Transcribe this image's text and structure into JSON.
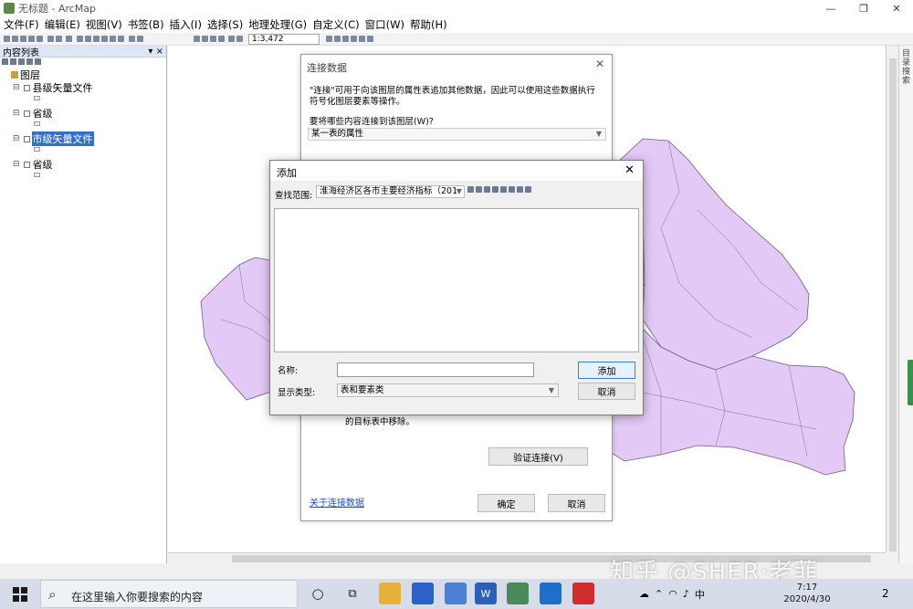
{
  "window": {
    "title": "无标题 - ArcMap"
  },
  "menu": [
    "文件(F)",
    "编辑(E)",
    "视图(V)",
    "书签(B)",
    "插入(I)",
    "选择(S)",
    "地理处理(G)",
    "自定义(C)",
    "窗口(W)",
    "帮助(H)"
  ],
  "toolbar": {
    "scale": "1:3,472"
  },
  "toc": {
    "title": "内容列表",
    "root": "图层",
    "layers": [
      {
        "label": "县级矢量文件",
        "selected": false
      },
      {
        "label": "省级",
        "selected": false
      },
      {
        "label": "市级矢量文件",
        "selected": true
      },
      {
        "label": "省级",
        "selected": false
      }
    ]
  },
  "right_panel": {
    "label": "目录 搜索"
  },
  "join_dialog": {
    "title": "连接数据",
    "description": "\"连接\"可用于向该图层的属性表追加其他数据，因此可以使用这些数据执行符号化图层要素等操作。",
    "question": "要将哪些内容连接到该图层(W)?",
    "selected_option": "某一表的属性",
    "note": "的目标表中移除。",
    "validate_label": "验证连接(V)",
    "link_label": "关于连接数据",
    "ok_label": "确定",
    "cancel_label": "取消"
  },
  "add_dialog": {
    "title": "添加",
    "look_in_label": "查找范围:",
    "look_in_value": "淮海经济区各市主要经济指标（201",
    "name_label": "名称:",
    "name_value": "",
    "type_label": "显示类型:",
    "type_value": "表和要素类",
    "add_label": "添加",
    "cancel_label": "取消"
  },
  "watermark": "知乎 @SHER·老菲",
  "taskbar": {
    "search_placeholder": "在这里输入你要搜索的内容",
    "tray_ime": "中",
    "date": "2020/4/30",
    "time": "7:17",
    "notifications": "2"
  },
  "colors": {
    "map_fill": "#e3c9f5",
    "map_stroke": "#6f5b86",
    "selection": "#3370c9"
  }
}
